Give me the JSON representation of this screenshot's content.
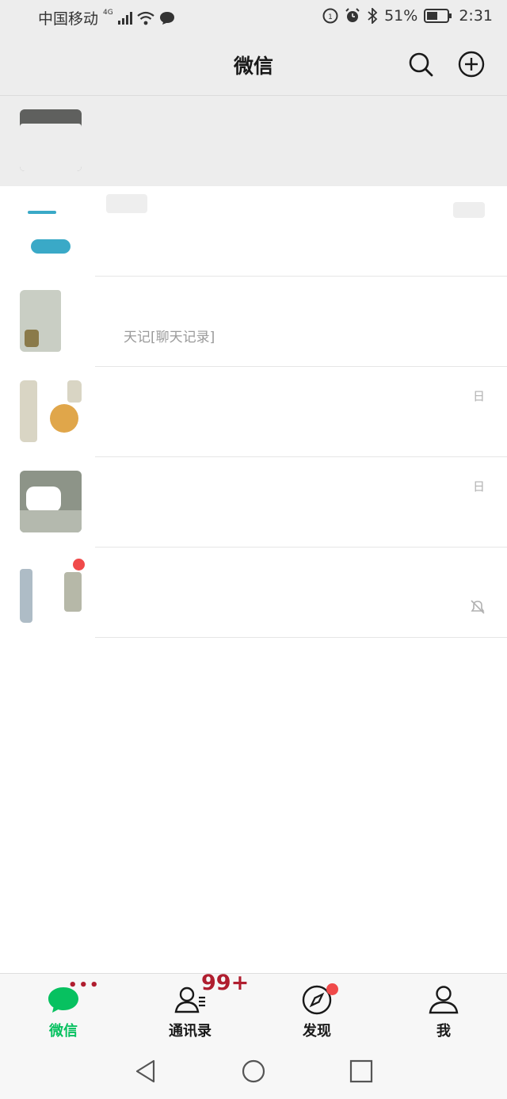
{
  "status_bar": {
    "carrier": "中国移动",
    "network": "4G",
    "battery": "51%",
    "time": "2:31"
  },
  "header": {
    "title": "微信"
  },
  "chats": [
    {
      "name": "",
      "preview": "",
      "time": "",
      "pinned": true,
      "muted": false,
      "unread_dot": false
    },
    {
      "name": "",
      "preview": "",
      "time": "",
      "pinned": false,
      "muted": false,
      "unread_dot": false
    },
    {
      "name": "",
      "preview": "天记[聊天记录]",
      "time": "",
      "pinned": false,
      "muted": false,
      "unread_dot": false
    },
    {
      "name": "",
      "preview": "",
      "time": "日",
      "pinned": false,
      "muted": false,
      "unread_dot": false
    },
    {
      "name": "",
      "preview": "",
      "time": "日",
      "pinned": false,
      "muted": false,
      "unread_dot": false
    },
    {
      "name": "",
      "preview": "",
      "time": "",
      "pinned": false,
      "muted": true,
      "unread_dot": true
    }
  ],
  "tabs": [
    {
      "label": "微信",
      "active": true,
      "badge": "•••"
    },
    {
      "label": "通讯录",
      "active": false,
      "badge": "99+"
    },
    {
      "label": "发现",
      "active": false,
      "badge": ""
    },
    {
      "label": "我",
      "active": false,
      "badge": ""
    }
  ],
  "colors": {
    "accent": "#07c160",
    "badge_red": "#f04a4a",
    "badge_text": "#b01e2f",
    "header_bg": "#ededed"
  },
  "icons": {
    "search": "search-icon",
    "add": "plus-circle-icon",
    "mute": "bell-off-icon"
  }
}
